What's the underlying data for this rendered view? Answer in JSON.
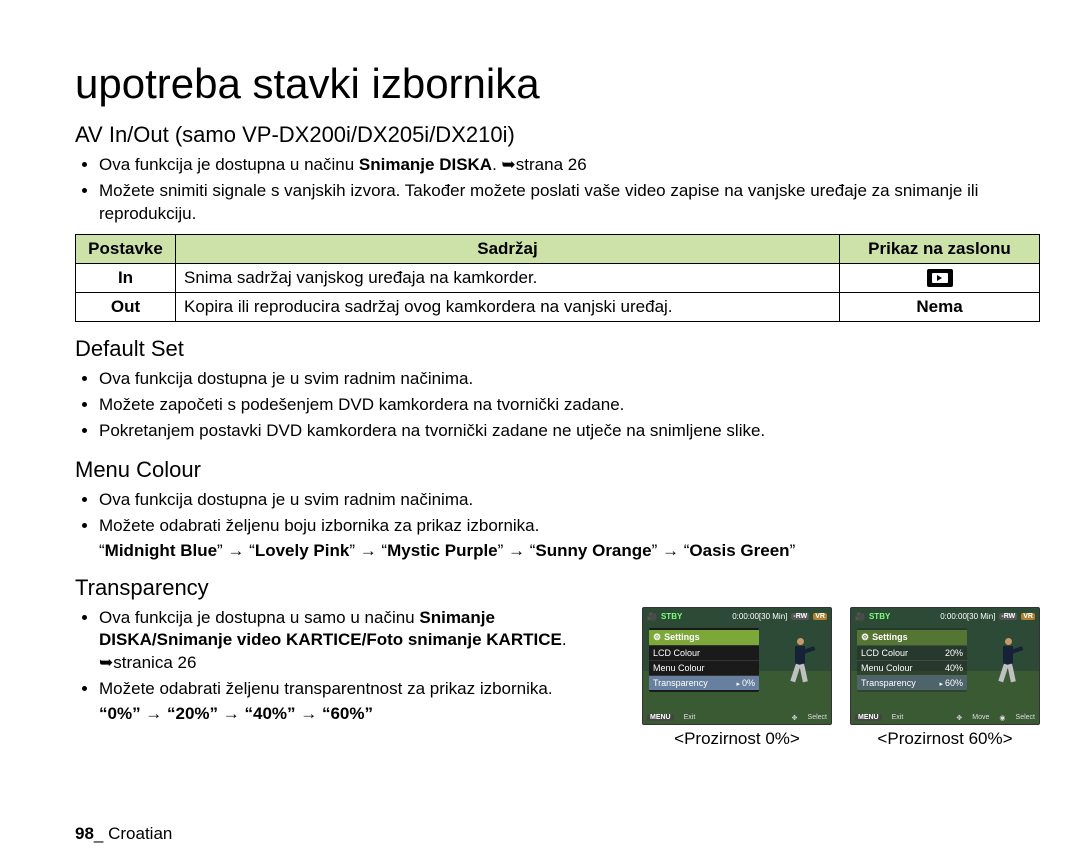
{
  "title": "upotreba stavki izbornika",
  "av": {
    "heading": "AV In/Out (samo VP-DX200i/DX205i/DX210i)",
    "bul1_a": "Ova funkcija je dostupna u načinu ",
    "bul1_b": "Snimanje DISKA",
    "bul1_c": ". ➥strana 26",
    "bul2": "Možete snimiti signale s vanjskih izvora. Također možete poslati vaše video zapise na vanjske uređaje za snimanje ili reprodukciju.",
    "th1": "Postavke",
    "th2": "Sadržaj",
    "th3": "Prikaz na zaslonu",
    "r1c1": "In",
    "r1c2": "Snima sadržaj vanjskog uređaja na kamkorder.",
    "r2c1": "Out",
    "r2c2": "Kopira ili reproducira sadržaj ovog kamkordera na vanjski uređaj.",
    "r2c3": "Nema"
  },
  "default_set": {
    "heading": "Default Set",
    "b1": "Ova funkcija dostupna je u svim radnim načinima.",
    "b2": "Možete započeti s podešenjem DVD kamkordera na tvornički zadane.",
    "b3": "Pokretanjem postavki DVD kamkordera na tvornički zadane ne utječe na snimljene slike."
  },
  "menu_colour": {
    "heading": "Menu Colour",
    "b1": "Ova funkcija dostupna je u svim radnim načinima.",
    "b2": "Možete odabrati željenu boju izbornika za prikaz izbornika.",
    "opts_prefix": "“",
    "o1": "Midnight Blue",
    "o2": "Lovely Pink",
    "o3": "Mystic Purple",
    "o4": "Sunny Orange",
    "o5": "Oasis Green",
    "sep": "” → “",
    "suffix": "”"
  },
  "transparency": {
    "heading": "Transparency",
    "b1_a": "Ova funkcija je dostupna u samo u načinu ",
    "b1_b": "Snimanje DISKA/Snimanje video KARTICE/Foto snimanje KARTICE",
    "b1_c": ". ➥stranica 26",
    "b2": "Možete odabrati željenu transparentnost za prikaz izbornika.",
    "opts": "“0%” → “20%” → “40%” → “60%”"
  },
  "thumbs": {
    "stby": "STBY",
    "time": "0:00:00[30 Min]",
    "rw": "-RW",
    "vr": "VR",
    "settings": "Settings",
    "lcd": "LCD Colour",
    "menucol": "Menu Colour",
    "trans": "Transparency",
    "v0": "0%",
    "v20": "20%",
    "v40": "40%",
    "v60": "60%",
    "menu_btn": "MENU",
    "exit": "Exit",
    "move": "Move",
    "select": "Select",
    "cap0": "<Prozirnost 0%>",
    "cap60": "<Prozirnost 60%>"
  },
  "footer": {
    "page": "98",
    "sep": "_ ",
    "lang": "Croatian"
  }
}
